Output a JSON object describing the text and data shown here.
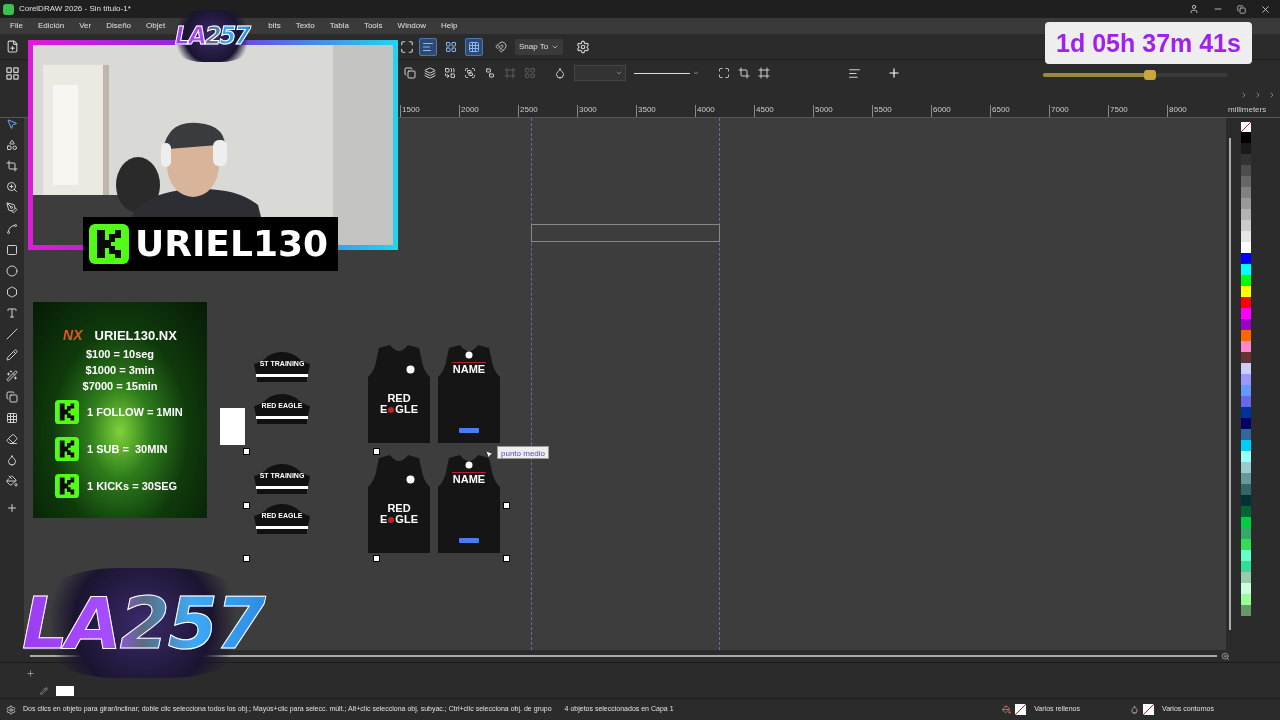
{
  "window": {
    "title": "CorelDRAW 2026 - Sin título-1*"
  },
  "menu": [
    {
      "label": "File"
    },
    {
      "label": "Edición"
    },
    {
      "label": "Ver"
    },
    {
      "label": "Diseño"
    },
    {
      "label": "Objet"
    },
    {
      "label": "bits"
    },
    {
      "label": "Texto"
    },
    {
      "label": "Tabla"
    },
    {
      "label": "Tools"
    },
    {
      "label": "Window"
    },
    {
      "label": "Help"
    }
  ],
  "toolbar_toggles": [
    {
      "selected": false
    },
    {
      "selected": true
    },
    {
      "selected": false
    },
    {
      "selected": true
    }
  ],
  "snap": {
    "label": "Snap To"
  },
  "arrange_tools": [
    {
      "disabled": false
    },
    {
      "disabled": false
    },
    {
      "disabled": false
    },
    {
      "disabled": false
    },
    {
      "disabled": false
    },
    {
      "disabled": true
    },
    {
      "disabled": true
    }
  ],
  "timer": {
    "text": "1d 05h 37m 41s",
    "level": 0.58
  },
  "ruler": {
    "labels": [
      "1500",
      "2000",
      "2500",
      "3000",
      "3500",
      "4000",
      "4500",
      "5000",
      "5500",
      "6000",
      "6500",
      "7000",
      "7500",
      "8000"
    ],
    "unit": "millimeters"
  },
  "webcam": {
    "name": "URIEL130"
  },
  "logos": [
    {
      "text": "LA257"
    },
    {
      "text": "LA257"
    }
  ],
  "donation_panel": {
    "brand": "NX",
    "title": "URIEL130.NX",
    "rates": [
      "$100 = 10seg",
      "$1000 = 3min",
      "$7000 = 15min"
    ],
    "kick_rates": [
      "1 FOLLOW = 1MIN",
      "1 SUB =  30MIN",
      "1 KICKs = 30SEG"
    ]
  },
  "collars": [
    {
      "text": "ST TRAINING"
    },
    {
      "text": "RED EAGLE"
    },
    {
      "text": "ST TRAINING"
    },
    {
      "text": "RED EAGLE"
    }
  ],
  "jerseys": [
    {
      "kind": "front",
      "line1": "RED",
      "line2a": "E",
      "line2b": "GLE"
    },
    {
      "kind": "back",
      "name": "NAME"
    },
    {
      "kind": "front",
      "line1": "RED",
      "line2a": "E",
      "line2b": "GLE"
    },
    {
      "kind": "back",
      "name": "NAME"
    }
  ],
  "tooltip": {
    "text": "punto medio"
  },
  "palette": [
    {
      "color": "#000000"
    },
    {
      "color": "#1a1a1a"
    },
    {
      "color": "#333333"
    },
    {
      "color": "#4d4d4d"
    },
    {
      "color": "#666666"
    },
    {
      "color": "#808080"
    },
    {
      "color": "#999999"
    },
    {
      "color": "#b3b3b3"
    },
    {
      "color": "#cccccc"
    },
    {
      "color": "#e6e6e6"
    },
    {
      "color": "#ffffff"
    },
    {
      "color": "#0000ff"
    },
    {
      "color": "#00ffff"
    },
    {
      "color": "#00ff00"
    },
    {
      "color": "#ffff00"
    },
    {
      "color": "#ff0000"
    },
    {
      "color": "#ff00ff"
    },
    {
      "color": "#9900cc"
    },
    {
      "color": "#ff6600"
    },
    {
      "color": "#ff88cc"
    },
    {
      "color": "#663333"
    },
    {
      "color": "#ccccff"
    },
    {
      "color": "#9999ff"
    },
    {
      "color": "#6699ff"
    },
    {
      "color": "#6666ee"
    },
    {
      "color": "#003399"
    },
    {
      "color": "#000066"
    },
    {
      "color": "#336699"
    },
    {
      "color": "#00ccff"
    },
    {
      "color": "#99ffff"
    },
    {
      "color": "#99cccc"
    },
    {
      "color": "#669999"
    },
    {
      "color": "#336666"
    },
    {
      "color": "#003333"
    },
    {
      "color": "#006633"
    },
    {
      "color": "#00cc44"
    },
    {
      "color": "#33aa66"
    },
    {
      "color": "#33dd55"
    },
    {
      "color": "#66ffcc"
    },
    {
      "color": "#33dd99"
    },
    {
      "color": "#99ccaa"
    },
    {
      "color": "#ccffdd"
    },
    {
      "color": "#99ff99"
    },
    {
      "color": "#669966"
    }
  ],
  "status_bar": {
    "hint": "Dos clics en objeto para girar/inclinar; doble clic selecciona todos los obj.; Mayús+clic para selecc. múlt.; Alt+clic selecciona obj. subyac.; Ctrl+clic selecciona obj. de grupo",
    "selection": "4 objetos seleccionados en Capa 1",
    "fill": "Varios rellenos",
    "outline": "Varios contornos"
  }
}
